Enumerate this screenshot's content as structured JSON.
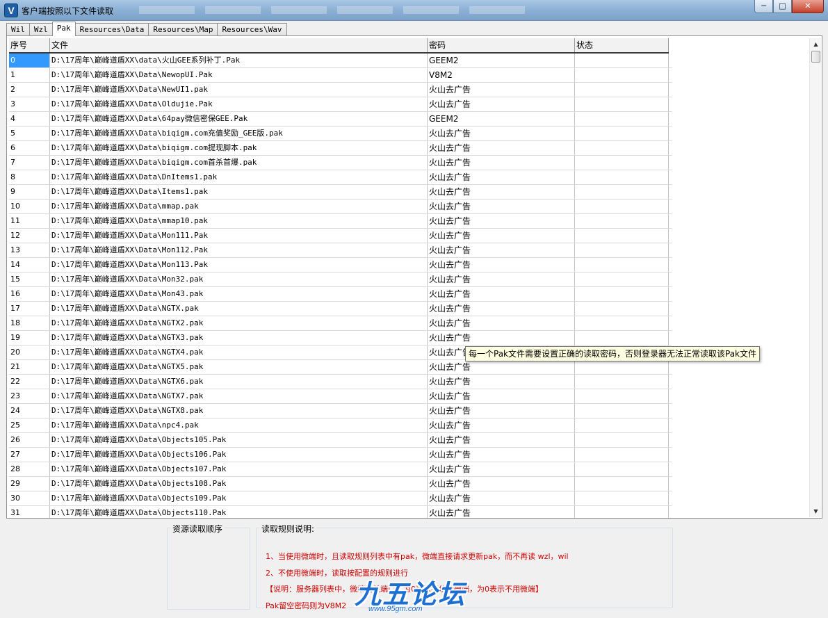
{
  "window": {
    "title": "客户端按照以下文件读取",
    "app_icon": "V",
    "min_glyph": "─",
    "max_glyph": "□",
    "close_glyph": "✕"
  },
  "tabs": [
    {
      "label": "Wil"
    },
    {
      "label": "Wzl"
    },
    {
      "label": "Pak",
      "active": true
    },
    {
      "label": "Resources\\Data"
    },
    {
      "label": "Resources\\Map"
    },
    {
      "label": "Resources\\Wav"
    }
  ],
  "grid": {
    "headers": [
      "序号",
      "文件",
      "密码",
      "状态"
    ],
    "rows": [
      [
        "0",
        "D:\\17周年\\巅峰道盾XX\\data\\火山GEE系列补丁.Pak",
        "GEEM2",
        ""
      ],
      [
        "1",
        "D:\\17周年\\巅峰道盾XX\\Data\\NewopUI.Pak",
        "V8M2",
        ""
      ],
      [
        "2",
        "D:\\17周年\\巅峰道盾XX\\Data\\NewUI1.pak",
        "火山去广告",
        ""
      ],
      [
        "3",
        "D:\\17周年\\巅峰道盾XX\\Data\\Oldujie.Pak",
        "火山去广告",
        ""
      ],
      [
        "4",
        "D:\\17周年\\巅峰道盾XX\\Data\\64pay微信密保GEE.Pak",
        "GEEM2",
        ""
      ],
      [
        "5",
        "D:\\17周年\\巅峰道盾XX\\Data\\biqigm.com充值奖励_GEE版.pak",
        "火山去广告",
        ""
      ],
      [
        "6",
        "D:\\17周年\\巅峰道盾XX\\Data\\biqigm.com提现脚本.pak",
        "火山去广告",
        ""
      ],
      [
        "7",
        "D:\\17周年\\巅峰道盾XX\\Data\\biqigm.com首杀首爆.pak",
        "火山去广告",
        ""
      ],
      [
        "8",
        "D:\\17周年\\巅峰道盾XX\\Data\\DnItems1.pak",
        "火山去广告",
        ""
      ],
      [
        "9",
        "D:\\17周年\\巅峰道盾XX\\Data\\Items1.pak",
        "火山去广告",
        ""
      ],
      [
        "10",
        "D:\\17周年\\巅峰道盾XX\\Data\\mmap.pak",
        "火山去广告",
        ""
      ],
      [
        "11",
        "D:\\17周年\\巅峰道盾XX\\Data\\mmap10.pak",
        "火山去广告",
        ""
      ],
      [
        "12",
        "D:\\17周年\\巅峰道盾XX\\Data\\Mon111.Pak",
        "火山去广告",
        ""
      ],
      [
        "13",
        "D:\\17周年\\巅峰道盾XX\\Data\\Mon112.Pak",
        "火山去广告",
        ""
      ],
      [
        "14",
        "D:\\17周年\\巅峰道盾XX\\Data\\Mon113.Pak",
        "火山去广告",
        ""
      ],
      [
        "15",
        "D:\\17周年\\巅峰道盾XX\\Data\\Mon32.pak",
        "火山去广告",
        ""
      ],
      [
        "16",
        "D:\\17周年\\巅峰道盾XX\\Data\\Mon43.pak",
        "火山去广告",
        ""
      ],
      [
        "17",
        "D:\\17周年\\巅峰道盾XX\\Data\\NGTX.pak",
        "火山去广告",
        ""
      ],
      [
        "18",
        "D:\\17周年\\巅峰道盾XX\\Data\\NGTX2.pak",
        "火山去广告",
        ""
      ],
      [
        "19",
        "D:\\17周年\\巅峰道盾XX\\Data\\NGTX3.pak",
        "火山去广告",
        ""
      ],
      [
        "20",
        "D:\\17周年\\巅峰道盾XX\\Data\\NGTX4.pak",
        "火山去广告",
        ""
      ],
      [
        "21",
        "D:\\17周年\\巅峰道盾XX\\Data\\NGTX5.pak",
        "火山去广告",
        ""
      ],
      [
        "22",
        "D:\\17周年\\巅峰道盾XX\\Data\\NGTX6.pak",
        "火山去广告",
        ""
      ],
      [
        "23",
        "D:\\17周年\\巅峰道盾XX\\Data\\NGTX7.pak",
        "火山去广告",
        ""
      ],
      [
        "24",
        "D:\\17周年\\巅峰道盾XX\\Data\\NGTX8.pak",
        "火山去广告",
        ""
      ],
      [
        "25",
        "D:\\17周年\\巅峰道盾XX\\Data\\npc4.pak",
        "火山去广告",
        ""
      ],
      [
        "26",
        "D:\\17周年\\巅峰道盾XX\\Data\\Objects105.Pak",
        "火山去广告",
        ""
      ],
      [
        "27",
        "D:\\17周年\\巅峰道盾XX\\Data\\Objects106.Pak",
        "火山去广告",
        ""
      ],
      [
        "28",
        "D:\\17周年\\巅峰道盾XX\\Data\\Objects107.Pak",
        "火山去广告",
        ""
      ],
      [
        "29",
        "D:\\17周年\\巅峰道盾XX\\Data\\Objects108.Pak",
        "火山去广告",
        ""
      ],
      [
        "30",
        "D:\\17周年\\巅峰道盾XX\\Data\\Objects109.Pak",
        "火山去广告",
        ""
      ],
      [
        "31",
        "D:\\17周年\\巅峰道盾XX\\Data\\Objects110.Pak",
        "火山去广告",
        ""
      ]
    ],
    "selected_row": 0
  },
  "tooltip": "每一个Pak文件需要设置正确的读取密码，否则登录器无法正常读取该Pak文件",
  "lower": {
    "resource_order_label": "资源读取顺序",
    "rules_label": "读取规则说明:",
    "rules": [
      "1、当使用微端时，且读取规则列表中有pak，微端直接请求更新pak，而不再读 wzl，wil",
      "2、不使用微端时，读取按配置的规则进行",
      "【说明：服务器列表中，微端网关端口，为0表示不使用微端，为0表示不用微端】",
      "Pak留空密码则为V8M2"
    ]
  },
  "watermark": {
    "text": "九五论坛",
    "url": "www.95gm.com"
  },
  "colors": {
    "selection": "#3399ff",
    "rule_text": "#d10000",
    "tooltip_bg": "#ffffe1",
    "watermark": "#1d6fd1"
  }
}
